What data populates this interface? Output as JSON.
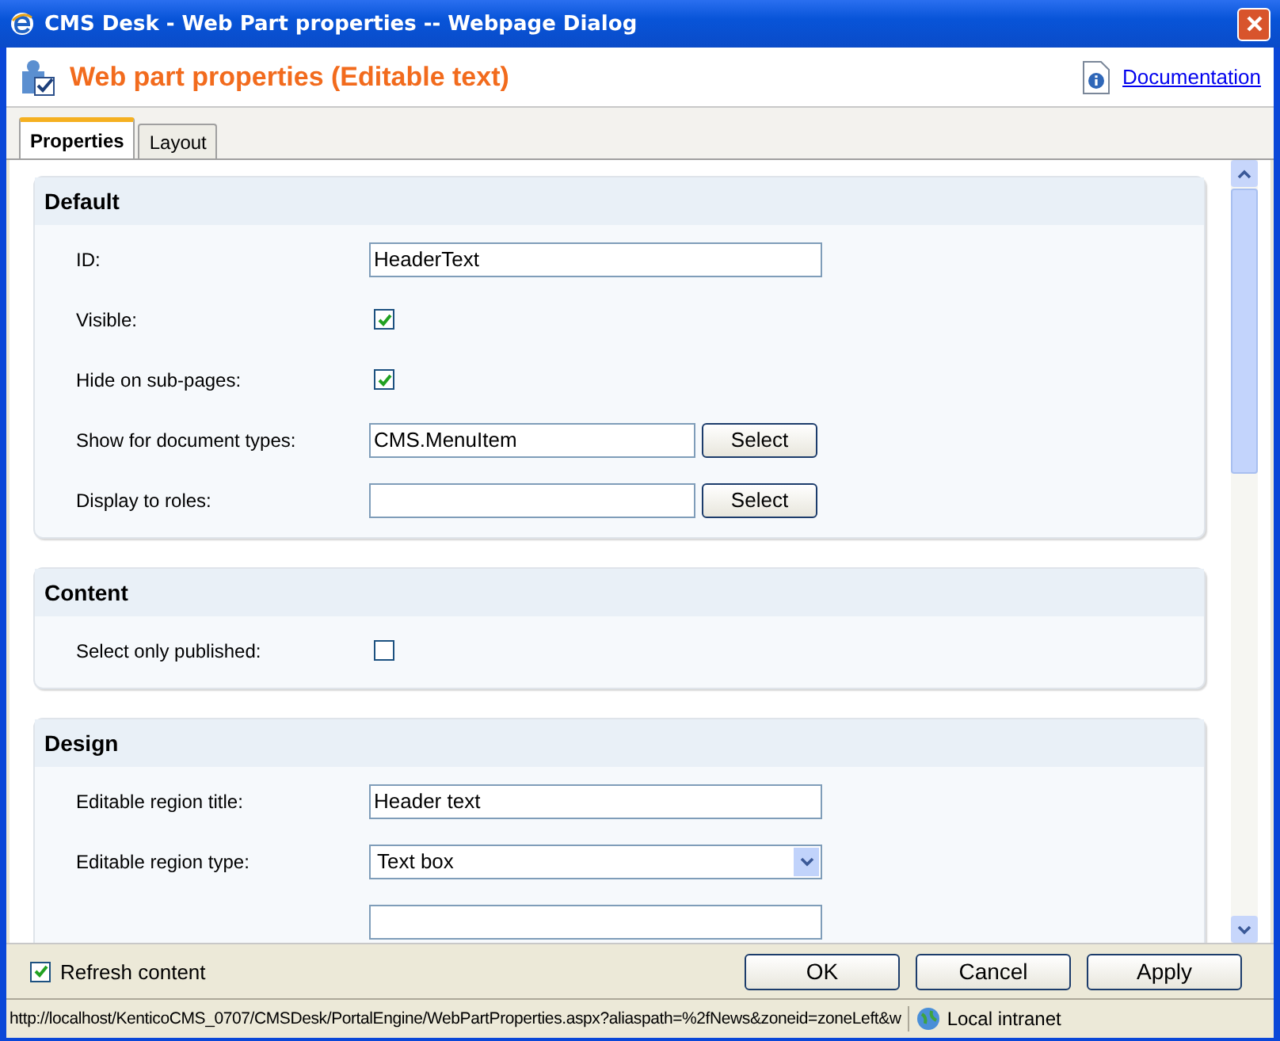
{
  "window": {
    "title": "CMS Desk - Web Part properties -- Webpage Dialog"
  },
  "header": {
    "title": "Web part properties (Editable text)",
    "link": "Documentation"
  },
  "tabs": [
    {
      "label": "Properties",
      "selected": true
    },
    {
      "label": "Layout",
      "selected": false
    }
  ],
  "sections": [
    {
      "title": "Default",
      "fields": [
        {
          "kind": "text",
          "label": "ID:",
          "value": "HeaderText"
        },
        {
          "kind": "checkbox",
          "label": "Visible:",
          "checked": true
        },
        {
          "kind": "checkbox",
          "label": "Hide on sub-pages:",
          "checked": true
        },
        {
          "kind": "select",
          "label": "Show for document types:",
          "value": "CMS.MenuItem",
          "button": "Select"
        },
        {
          "kind": "select",
          "label": "Display to roles:",
          "button": "Select"
        }
      ]
    },
    {
      "title": "Content",
      "fields": [
        {
          "kind": "checkbox",
          "label": "Select only published:",
          "checked": false
        }
      ]
    },
    {
      "title": "Design",
      "fields": [
        {
          "kind": "text",
          "label": "Editable region title:",
          "value": "Header text"
        },
        {
          "kind": "dropdown",
          "label": "Editable region type:",
          "value": "Text box"
        },
        {
          "kind": "text"
        }
      ]
    }
  ],
  "footer": {
    "refresh": {
      "label": "Refresh content",
      "checked": true
    },
    "buttons": [
      "OK",
      "Cancel",
      "Apply"
    ]
  },
  "status_bar": {
    "url": "http://localhost/KenticoCMS_0707/CMSDesk/PortalEngine/WebPartProperties.aspx?aliaspath=%2fNews&zoneid=zoneLeft&w",
    "zone": "Local intranet"
  }
}
